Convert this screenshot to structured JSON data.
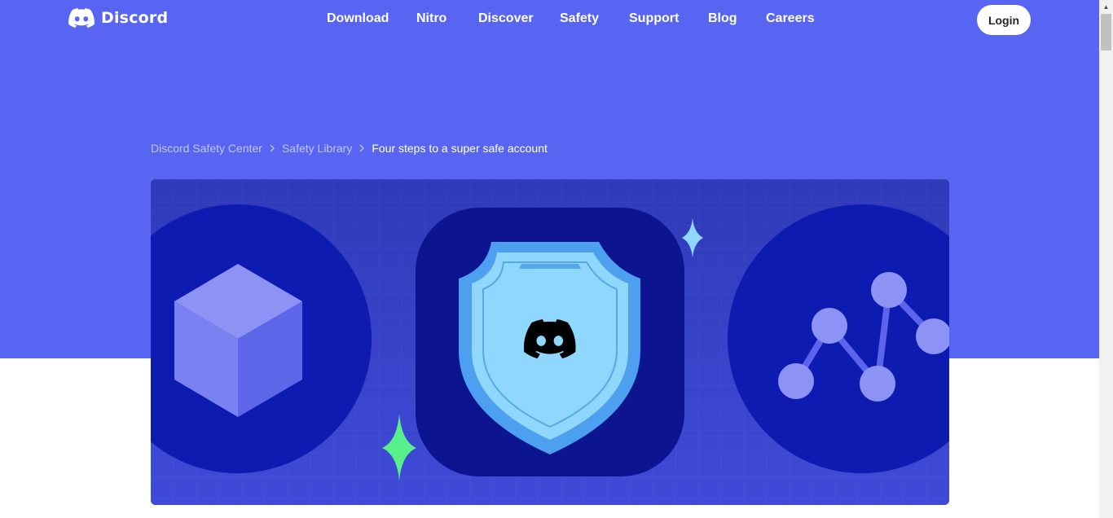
{
  "header": {
    "logo_text": "Discord",
    "nav": [
      {
        "label": "Download"
      },
      {
        "label": "Nitro"
      },
      {
        "label": "Discover"
      },
      {
        "label": "Safety"
      },
      {
        "label": "Support"
      },
      {
        "label": "Blog"
      },
      {
        "label": "Careers"
      }
    ],
    "login_label": "Login"
  },
  "breadcrumb": {
    "items": [
      {
        "label": "Discord Safety Center"
      },
      {
        "label": "Safety Library"
      }
    ],
    "current": "Four steps to a super safe account"
  },
  "banner": {
    "icons": [
      "cube-icon",
      "shield-icon",
      "network-graph-icon",
      "sparkle-icon"
    ]
  },
  "colors": {
    "blurple": "#5865f2",
    "banner_bg": "#3a46d2",
    "dark_circle": "#0e1bb0",
    "shield_light": "#8fd7fc",
    "shield_mid": "#5aa6f0",
    "sparkle_green": "#58f08a",
    "sparkle_blue": "#8fd7fc"
  }
}
